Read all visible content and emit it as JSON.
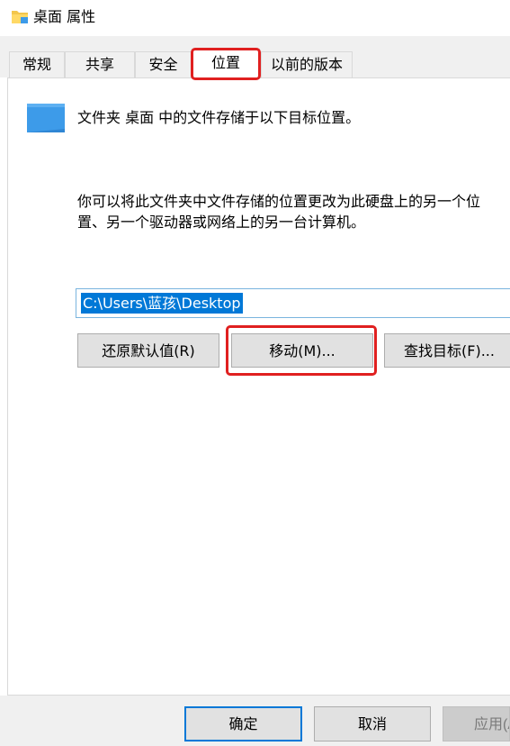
{
  "window": {
    "title": "桌面 属性",
    "icon": "folder-icon"
  },
  "tabs": [
    {
      "label": "常规",
      "active": false
    },
    {
      "label": "共享",
      "active": false
    },
    {
      "label": "安全",
      "active": false
    },
    {
      "label": "位置",
      "active": true
    },
    {
      "label": "以前的版本",
      "active": false
    }
  ],
  "location": {
    "folder_icon": "desktop-folder-icon",
    "info": "文件夹 桌面 中的文件存储于以下目标位置。",
    "description_line1": "你可以将此文件夹中文件存储的位置更改为此硬盘上的另一个位",
    "description_line2": "置、另一个驱动器或网络上的另一台计算机。",
    "path_value": "C:\\Users\\蓝孩\\Desktop",
    "buttons": {
      "restore_default": "还原默认值(R)",
      "move": "移动(M)...",
      "find_target": "查找目标(F)..."
    }
  },
  "footer": {
    "ok": "确定",
    "cancel": "取消",
    "apply": "应用(A)"
  },
  "colors": {
    "highlight": "#e02020",
    "selection": "#0078d7",
    "folder_blue": "#3d9be9"
  }
}
